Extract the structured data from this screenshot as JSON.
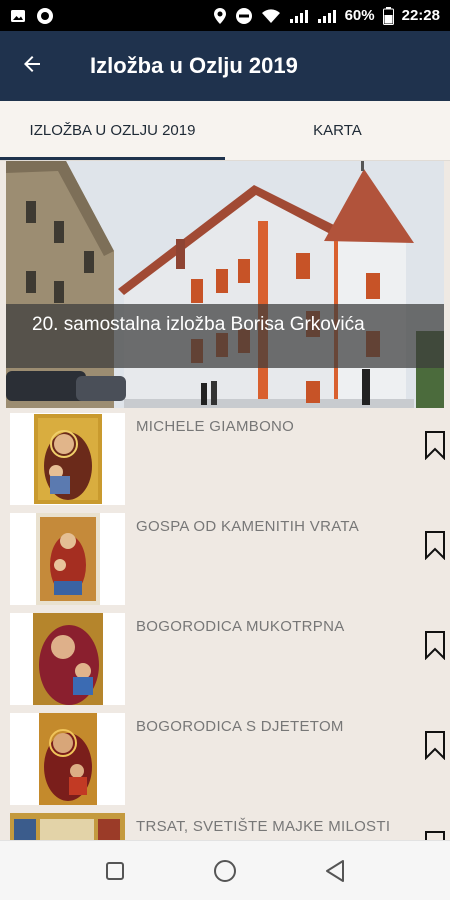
{
  "status_bar": {
    "battery": "60%",
    "time": "22:28",
    "icons": [
      "gallery-icon",
      "circle-icon",
      "location-icon",
      "do-not-disturb-icon",
      "wifi-icon",
      "signal-icon",
      "signal-icon",
      "battery-icon"
    ]
  },
  "app_bar": {
    "title": "Izložba u Ozlju 2019",
    "back_icon": "arrow-left-icon",
    "background": "#1f324d"
  },
  "tabs": [
    {
      "label": "IZLOŽBA U OZLJU 2019",
      "active": true
    },
    {
      "label": "KARTA",
      "active": false
    }
  ],
  "hero": {
    "caption": "20. samostalna izložba Borisa Grkovića"
  },
  "items": [
    {
      "title": "MICHELE GIAMBONO"
    },
    {
      "title": "GOSPA  OD  KAMENITIH  VRATA"
    },
    {
      "title": "BOGORODICA MUKOTRPNA"
    },
    {
      "title": "BOGORODICA S DJETETOM"
    },
    {
      "title": "TRSAT, SVETIŠTE MAJKE MILOSTI"
    }
  ],
  "nav_bar": {
    "icons": [
      "recent-apps-icon",
      "home-icon",
      "back-icon"
    ]
  }
}
